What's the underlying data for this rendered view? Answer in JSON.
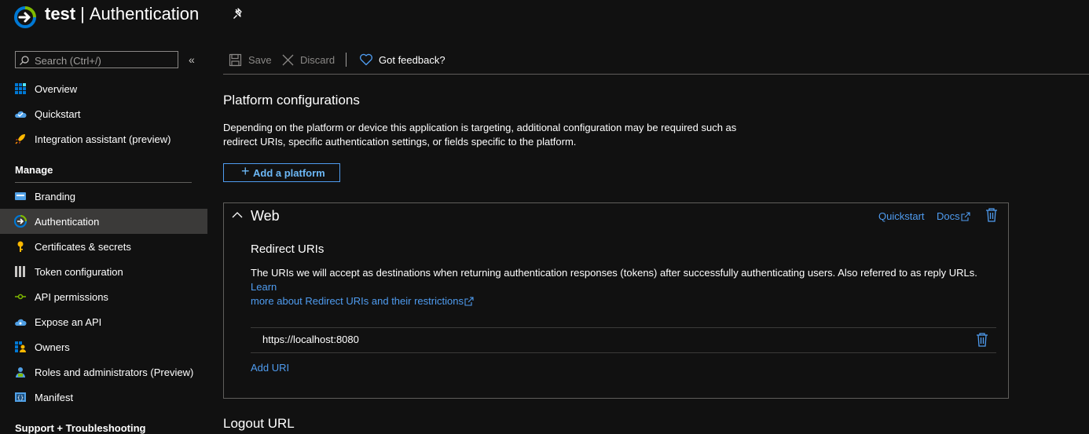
{
  "header": {
    "title_bold": "test",
    "title_rest": "Authentication",
    "logo_icon": "app-registration-icon",
    "pin_icon": "pin-icon"
  },
  "sidebar": {
    "search_placeholder": "Search (Ctrl+/)",
    "collapse_label": "«",
    "items": [
      {
        "label": "Overview",
        "icon": "overview-grid-icon"
      },
      {
        "label": "Quickstart",
        "icon": "cloud-quickstart-icon"
      },
      {
        "label": "Integration assistant (preview)",
        "icon": "rocket-icon"
      }
    ],
    "manage_heading": "Manage",
    "manage_items": [
      {
        "label": "Branding",
        "icon": "branding-icon"
      },
      {
        "label": "Authentication",
        "icon": "authentication-icon",
        "selected": true
      },
      {
        "label": "Certificates & secrets",
        "icon": "key-icon"
      },
      {
        "label": "Token configuration",
        "icon": "token-bars-icon"
      },
      {
        "label": "API permissions",
        "icon": "api-permissions-icon"
      },
      {
        "label": "Expose an API",
        "icon": "cloud-expose-icon"
      },
      {
        "label": "Owners",
        "icon": "owners-icon"
      },
      {
        "label": "Roles and administrators (Preview)",
        "icon": "roles-icon"
      },
      {
        "label": "Manifest",
        "icon": "manifest-icon"
      }
    ],
    "support_heading": "Support + Troubleshooting"
  },
  "toolbar": {
    "save_label": "Save",
    "discard_label": "Discard",
    "feedback_label": "Got feedback?"
  },
  "main": {
    "platform_heading": "Platform configurations",
    "platform_desc_line1": "Depending on the platform or device this application is targeting, additional configuration may be required such as",
    "platform_desc_line2": "redirect URIs, specific authentication settings, or fields specific to the platform.",
    "add_platform_label": "Add a platform",
    "web": {
      "title": "Web",
      "quickstart_link": "Quickstart",
      "docs_link": "Docs",
      "redirect_heading": "Redirect URIs",
      "redirect_desc": "The URIs we will accept as destinations when returning authentication responses (tokens) after successfully authenticating users. Also referred to as reply URLs.",
      "learn_more_part1": "Learn",
      "learn_more_part2": "more about Redirect URIs and their restrictions",
      "uris": [
        "https://localhost:8080"
      ],
      "add_uri_label": "Add URI"
    },
    "logout_heading": "Logout URL"
  },
  "colors": {
    "background": "#111111",
    "accent": "#4f9cf0",
    "selected": "#3b3a39",
    "border": "#605e5c"
  }
}
